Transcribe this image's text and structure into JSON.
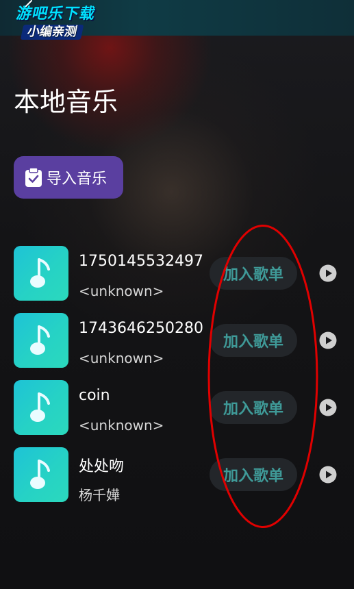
{
  "watermark": {
    "line1": "游吧乐下载",
    "line2": "小编亲测"
  },
  "header": {
    "title": "本地音乐"
  },
  "toolbar": {
    "import_label": "导入音乐",
    "import_icon": "clipboard-check-icon"
  },
  "songs": [
    {
      "title": "1750145532497",
      "artist": "<unknown>",
      "add_label": "加入歌单",
      "play_icon": "play-icon"
    },
    {
      "title": "1743646250280",
      "artist": "<unknown>",
      "add_label": "加入歌单",
      "play_icon": "play-icon"
    },
    {
      "title": "coin",
      "artist": "<unknown>",
      "add_label": "加入歌单",
      "play_icon": "play-icon"
    },
    {
      "title": "处处吻",
      "artist": "杨千嬅",
      "add_label": "加入歌单",
      "play_icon": "play-icon"
    }
  ],
  "colors": {
    "accent_purple": "#5a3fa0",
    "thumb_teal": "#26d2c5",
    "add_text": "#3f9a98",
    "annotation_red": "#e00000"
  }
}
